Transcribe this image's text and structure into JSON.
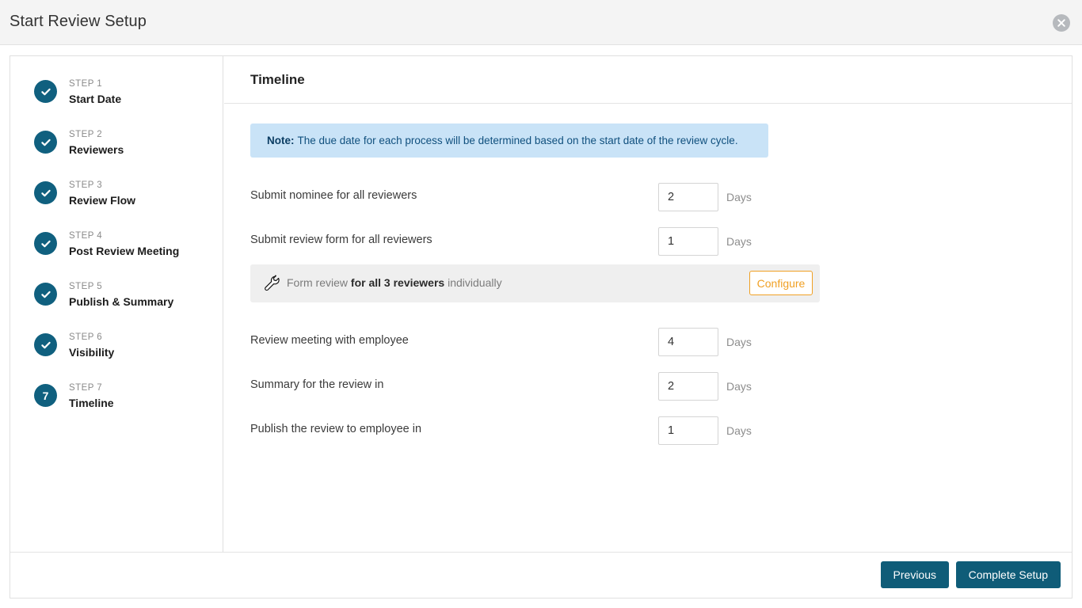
{
  "window": {
    "title": "Start Review Setup",
    "close_icon": "close-icon"
  },
  "sidebar": {
    "steps": [
      {
        "num": "STEP 1",
        "label": "Start Date",
        "state": "complete",
        "marker": "check-icon"
      },
      {
        "num": "STEP 2",
        "label": "Reviewers",
        "state": "complete",
        "marker": "check-icon"
      },
      {
        "num": "STEP 3",
        "label": "Review Flow",
        "state": "complete",
        "marker": "check-icon"
      },
      {
        "num": "STEP 4",
        "label": "Post Review Meeting",
        "state": "complete",
        "marker": "check-icon"
      },
      {
        "num": "STEP 5",
        "label": "Publish & Summary",
        "state": "complete",
        "marker": "check-icon"
      },
      {
        "num": "STEP 6",
        "label": "Visibility",
        "state": "complete",
        "marker": "check-icon"
      },
      {
        "num": "STEP 7",
        "label": "Timeline",
        "state": "current",
        "marker": "7"
      }
    ]
  },
  "main": {
    "panel_title": "Timeline",
    "note": {
      "prefix": "Note:",
      "text": "The due date for each process will be determined based on the start date of the review cycle."
    },
    "rows": [
      {
        "label": "Submit nominee for all reviewers",
        "value": "2",
        "unit": "Days"
      },
      {
        "label": "Submit review form for all reviewers",
        "value": "1",
        "unit": "Days"
      },
      {
        "label": "Review meeting with employee",
        "value": "4",
        "unit": "Days"
      },
      {
        "label": "Summary for the review in",
        "value": "2",
        "unit": "Days"
      },
      {
        "label": "Publish the review to employee in",
        "value": "1",
        "unit": "Days"
      }
    ],
    "configure": {
      "icon": "wrench-icon",
      "text_before": "Form review ",
      "text_bold": "for all 3 reviewers",
      "text_after": " individually",
      "button_label": "Configure"
    }
  },
  "footer": {
    "previous_label": "Previous",
    "complete_label": "Complete Setup"
  },
  "colors": {
    "accent_teal": "#0f5c78",
    "note_bg": "#c9e3f7",
    "note_text": "#10507e",
    "configure_orange": "#f0a024",
    "strip_bg": "#efefef",
    "titlebar_bg": "#f4f4f4"
  }
}
